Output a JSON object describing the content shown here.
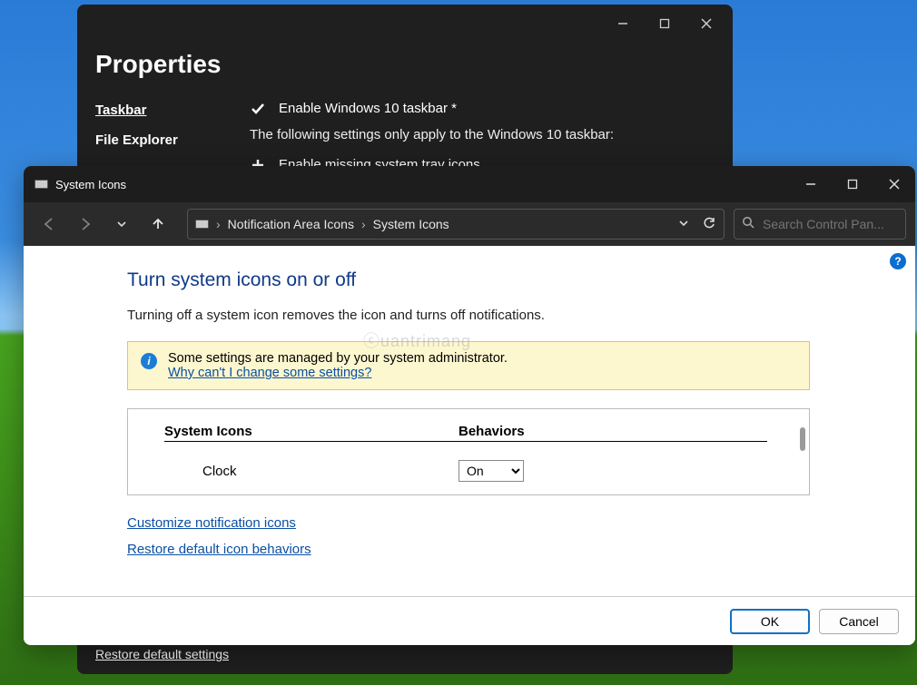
{
  "properties": {
    "title": "Properties",
    "sidebar": [
      {
        "label": "Taskbar",
        "active": true
      },
      {
        "label": "File Explorer",
        "active": false
      }
    ],
    "rows": [
      {
        "icon": "check",
        "text": "Enable Windows 10 taskbar *"
      },
      {
        "desc": "The following settings only apply to the Windows 10 taskbar:"
      },
      {
        "icon": "plus",
        "text": "Enable missing system tray icons"
      }
    ],
    "bottom_link": "Restore default settings"
  },
  "control_panel": {
    "window_title": "System Icons",
    "breadcrumbs": [
      "Notification Area Icons",
      "System Icons"
    ],
    "search_placeholder": "Search Control Pan...",
    "heading": "Turn system icons on or off",
    "subheading": "Turning off a system icon removes the icon and turns off notifications.",
    "admin_notice": "Some settings are managed by your system administrator.",
    "admin_link": "Why can't I change some settings?",
    "table": {
      "col_a": "System Icons",
      "col_b": "Behaviors",
      "rows": [
        {
          "name": "Clock",
          "value": "On"
        }
      ]
    },
    "link_customize": "Customize notification icons",
    "link_restore": "Restore default icon behaviors",
    "footer": {
      "ok": "OK",
      "cancel": "Cancel"
    }
  }
}
